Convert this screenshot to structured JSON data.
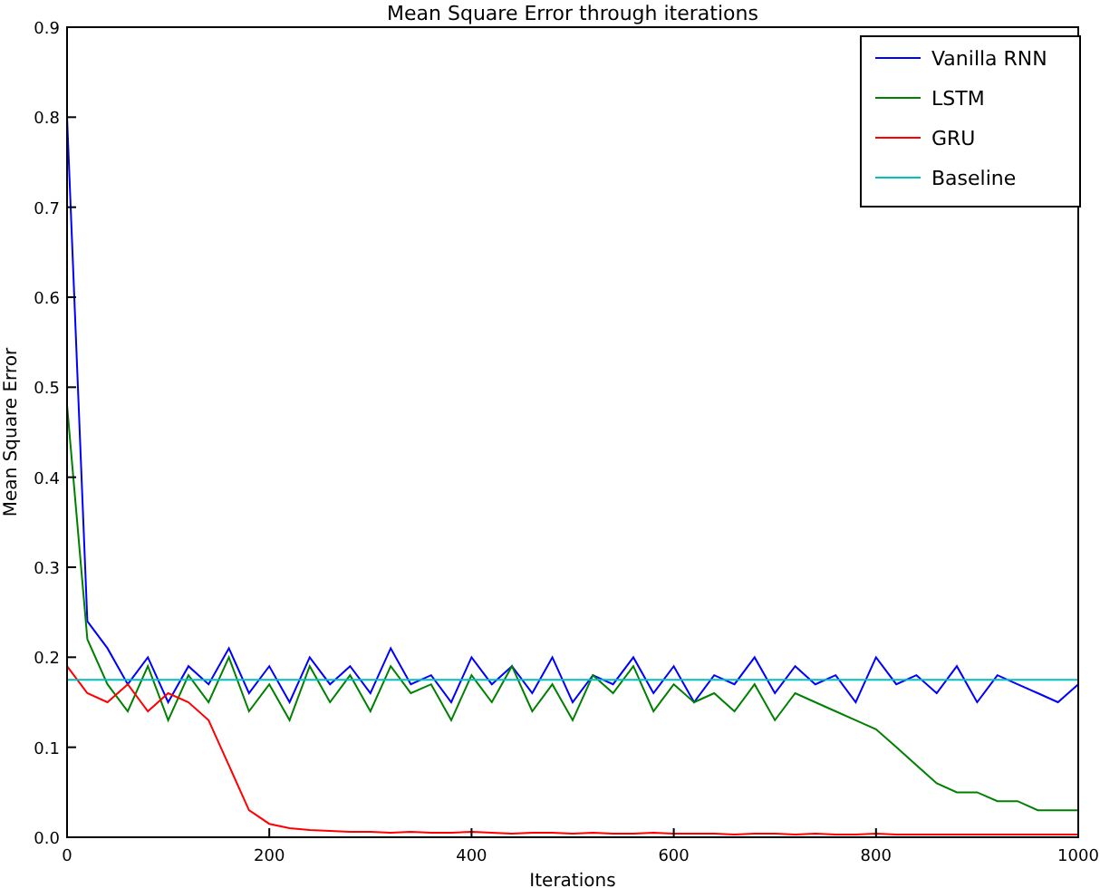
{
  "chart_data": {
    "type": "line",
    "title": "Mean Square Error through iterations",
    "xlabel": "Iterations",
    "ylabel": "Mean Square Error",
    "legend": "upper right",
    "xlim": [
      0,
      1000
    ],
    "ylim": [
      0,
      0.9
    ],
    "xticks": [
      0,
      200,
      400,
      600,
      800,
      1000
    ],
    "yticks": [
      {
        "value": 0,
        "label": "0.0"
      },
      {
        "value": 0.1,
        "label": "0.1"
      },
      {
        "value": 0.2,
        "label": "0.2"
      },
      {
        "value": 0.3,
        "label": "0.3"
      },
      {
        "value": 0.4,
        "label": "0.4"
      },
      {
        "value": 0.5,
        "label": "0.5"
      },
      {
        "value": 0.6,
        "label": "0.6"
      },
      {
        "value": 0.7,
        "label": "0.7"
      },
      {
        "value": 0.8,
        "label": "0.8"
      },
      {
        "value": 0.9,
        "label": "0.9"
      }
    ],
    "x": [
      0,
      20,
      40,
      60,
      80,
      100,
      120,
      140,
      160,
      180,
      200,
      220,
      240,
      260,
      280,
      300,
      320,
      340,
      360,
      380,
      400,
      420,
      440,
      460,
      480,
      500,
      520,
      540,
      560,
      580,
      600,
      620,
      640,
      660,
      680,
      700,
      720,
      740,
      760,
      780,
      800,
      820,
      840,
      860,
      880,
      900,
      920,
      940,
      960,
      980,
      1000
    ],
    "series": [
      {
        "name": "Vanilla RNN",
        "color": "#0000ff",
        "values": [
          0.8,
          0.24,
          0.21,
          0.17,
          0.2,
          0.15,
          0.19,
          0.17,
          0.21,
          0.16,
          0.19,
          0.15,
          0.2,
          0.17,
          0.19,
          0.16,
          0.21,
          0.17,
          0.18,
          0.15,
          0.2,
          0.17,
          0.19,
          0.16,
          0.2,
          0.15,
          0.18,
          0.17,
          0.2,
          0.16,
          0.19,
          0.15,
          0.18,
          0.17,
          0.2,
          0.16,
          0.19,
          0.17,
          0.18,
          0.15,
          0.2,
          0.17,
          0.18,
          0.16,
          0.19,
          0.15,
          0.18,
          0.17,
          0.16,
          0.15,
          0.17
        ]
      },
      {
        "name": "LSTM",
        "color": "#008000",
        "values": [
          0.48,
          0.22,
          0.17,
          0.14,
          0.19,
          0.13,
          0.18,
          0.15,
          0.2,
          0.14,
          0.17,
          0.13,
          0.19,
          0.15,
          0.18,
          0.14,
          0.19,
          0.16,
          0.17,
          0.13,
          0.18,
          0.15,
          0.19,
          0.14,
          0.17,
          0.13,
          0.18,
          0.16,
          0.19,
          0.14,
          0.17,
          0.15,
          0.16,
          0.14,
          0.17,
          0.13,
          0.16,
          0.15,
          0.14,
          0.13,
          0.12,
          0.1,
          0.08,
          0.06,
          0.05,
          0.05,
          0.04,
          0.04,
          0.03,
          0.03,
          0.03
        ]
      },
      {
        "name": "GRU",
        "color": "#ff0000",
        "values": [
          0.19,
          0.16,
          0.15,
          0.17,
          0.14,
          0.16,
          0.15,
          0.13,
          0.08,
          0.03,
          0.015,
          0.01,
          0.008,
          0.007,
          0.006,
          0.006,
          0.005,
          0.006,
          0.005,
          0.005,
          0.006,
          0.005,
          0.004,
          0.005,
          0.005,
          0.004,
          0.005,
          0.004,
          0.004,
          0.005,
          0.004,
          0.004,
          0.004,
          0.003,
          0.004,
          0.004,
          0.003,
          0.004,
          0.003,
          0.003,
          0.004,
          0.003,
          0.003,
          0.003,
          0.003,
          0.003,
          0.003,
          0.003,
          0.003,
          0.003,
          0.003
        ]
      },
      {
        "name": "Baseline",
        "color": "#00bfbf",
        "values": [
          0.175,
          0.175,
          0.175,
          0.175,
          0.175,
          0.175,
          0.175,
          0.175,
          0.175,
          0.175,
          0.175,
          0.175,
          0.175,
          0.175,
          0.175,
          0.175,
          0.175,
          0.175,
          0.175,
          0.175,
          0.175,
          0.175,
          0.175,
          0.175,
          0.175,
          0.175,
          0.175,
          0.175,
          0.175,
          0.175,
          0.175,
          0.175,
          0.175,
          0.175,
          0.175,
          0.175,
          0.175,
          0.175,
          0.175,
          0.175,
          0.175,
          0.175,
          0.175,
          0.175,
          0.175,
          0.175,
          0.175,
          0.175,
          0.175,
          0.175,
          0.175
        ]
      }
    ]
  }
}
